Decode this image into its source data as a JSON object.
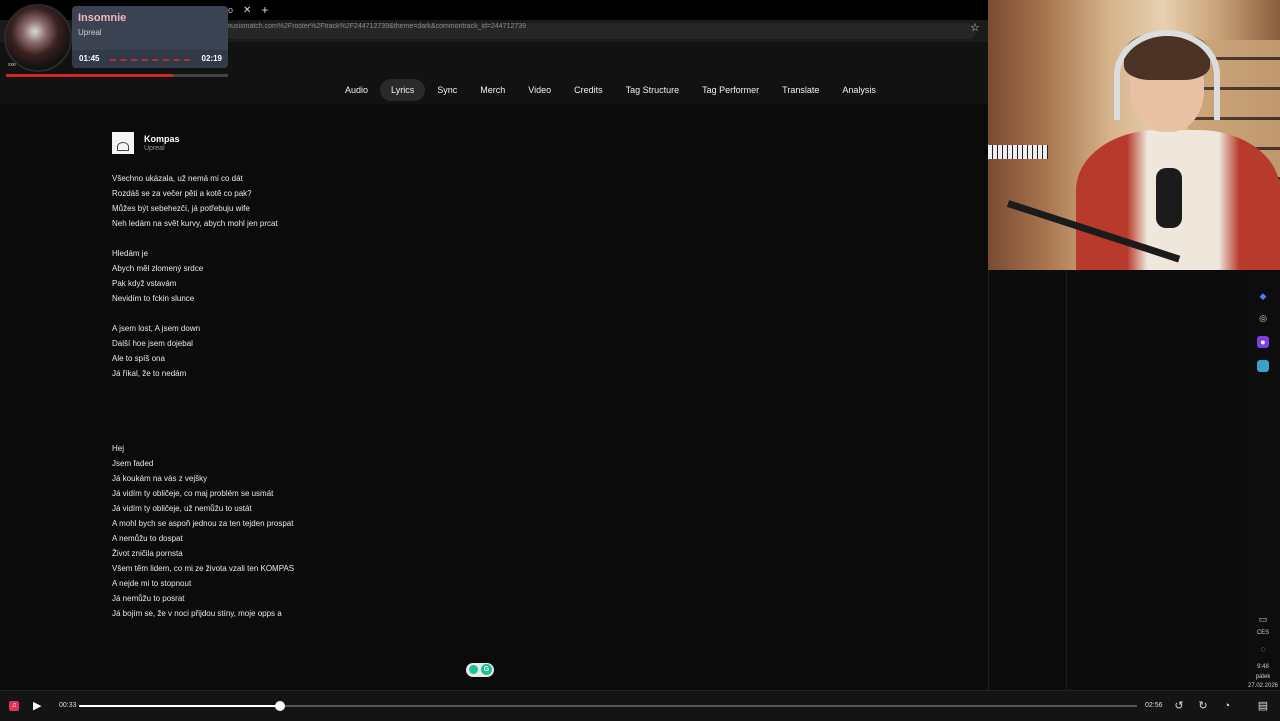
{
  "browser": {
    "url": "ebReferrerUrl=https%3A%2F%2Fpro.musixmatch.com%2Froster%2Ftrack%2F244712739&theme=dark&commontrack_id=244712739",
    "tab_partial": "o",
    "tab_close": "✕",
    "new_tab": "+"
  },
  "now_playing": {
    "title": "Insomnie",
    "artist": "Upreal",
    "elapsed": "01:45",
    "total": "02:19",
    "art_tag": "xxe",
    "progress": 0.75
  },
  "tabs": [
    {
      "label": "Audio",
      "active": false
    },
    {
      "label": "Lyrics",
      "active": true
    },
    {
      "label": "Sync",
      "active": false
    },
    {
      "label": "Merch",
      "active": false
    },
    {
      "label": "Video",
      "active": false
    },
    {
      "label": "Credits",
      "active": false
    },
    {
      "label": "Tag Structure",
      "active": false
    },
    {
      "label": "Tag Performer",
      "active": false
    },
    {
      "label": "Translate",
      "active": false
    },
    {
      "label": "Analysis",
      "active": false
    }
  ],
  "song": {
    "title": "Kompas",
    "artist": "Upreal"
  },
  "lyrics": [
    "Všechno ukázala, už nemá mi co dát",
    "Rozdáš se za večer pěti a kotě co pak?",
    "Můžes být sebehezčí, já potřebuju wife",
    "Neh ledám na svět kurvy, abych mohl jen prcat",
    "",
    "Hledám je",
    "Abych měl zlomený srdce",
    "Pak když vstavám",
    "Nevidím to fckin slunce",
    "",
    "A jsem lost, A jsem down",
    "Další hoe jsem dojebal",
    "Ale to spíš ona",
    "Já říkal, že to nedám",
    "",
    "",
    "",
    "",
    "Hej",
    "Jsem faded",
    "Já koukám na vás z vejšky",
    "Já vidím ty obličeje, co maj problém se usmát",
    "Já vidím ty obličeje, už nemůžu to ustát",
    "A mohl bych se aspoň jednou za ten tejden prospat",
    "A nemůžu to dospat",
    "Život zničila pornsta",
    "Všem těm lidem, co mi ze života vzali ten KOMPAS",
    "A nejde mi to stopnout",
    "Já nemůžu to posrat",
    "Já bojím se, že v noci přijdou stíny, moje opps a"
  ],
  "player": {
    "elapsed": "00:33",
    "total": "02:56",
    "progress": 0.19
  },
  "tray": {
    "lang": "CES",
    "time": "9:48",
    "day": "pátek",
    "date": "27.02.2026"
  },
  "colors": {
    "accent_red": "#d0262a",
    "grammarly": "#15c39a",
    "card": "#3b4252"
  },
  "icons": {
    "star": "star-icon",
    "play": "play-icon",
    "logo": "music-app-logo-icon"
  }
}
